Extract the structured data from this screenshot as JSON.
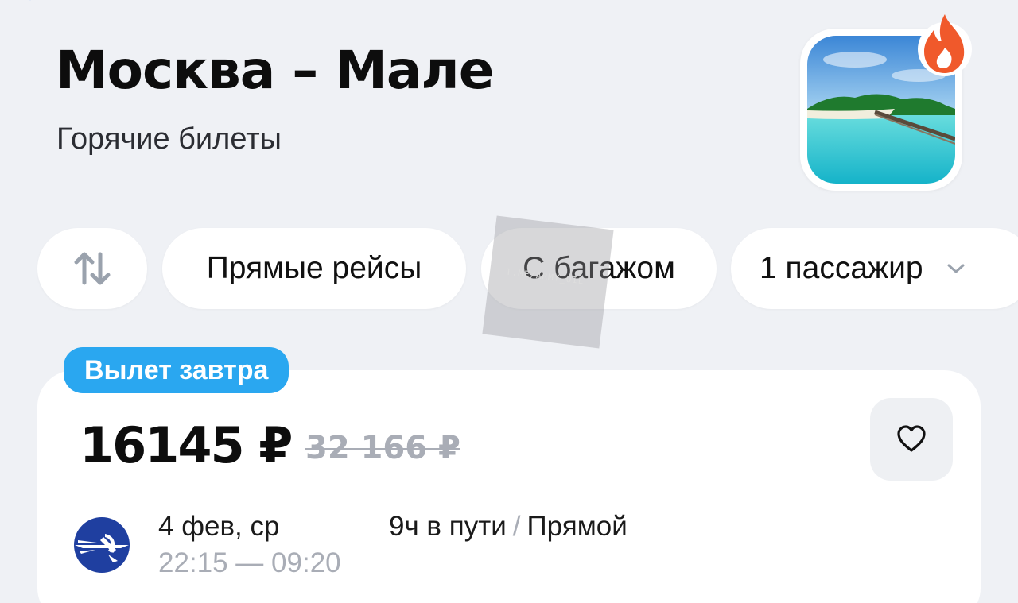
{
  "header": {
    "back_icon": "chevron-left-icon",
    "title": "Москва – Мале",
    "subtitle": "Горячие билеты",
    "hero_badge_icon": "fire-icon"
  },
  "filters": {
    "sort_icon": "sort-arrows-icon",
    "direct": "Прямые рейсы",
    "baggage": "С багажом",
    "passengers": "1 пассажир",
    "passengers_icon": "chevron-down-icon"
  },
  "watermark": "T.ME/ARMY_OIL",
  "offer": {
    "badge": "Вылет завтра",
    "price": "16145 ₽",
    "old_price": "32 166 ₽",
    "favorite_icon": "heart-icon",
    "airline_icon": "aeroflot-logo",
    "date": "4 фев, ср",
    "time_range": "22:15 — 09:20",
    "duration": "9ч в пути",
    "separator": "/",
    "stops": "Прямой"
  },
  "colors": {
    "background": "#eff1f5",
    "badge": "#2aa7f0",
    "fire": "#f0592b",
    "muted": "#a9adb6",
    "airline": "#1f3fa0"
  }
}
